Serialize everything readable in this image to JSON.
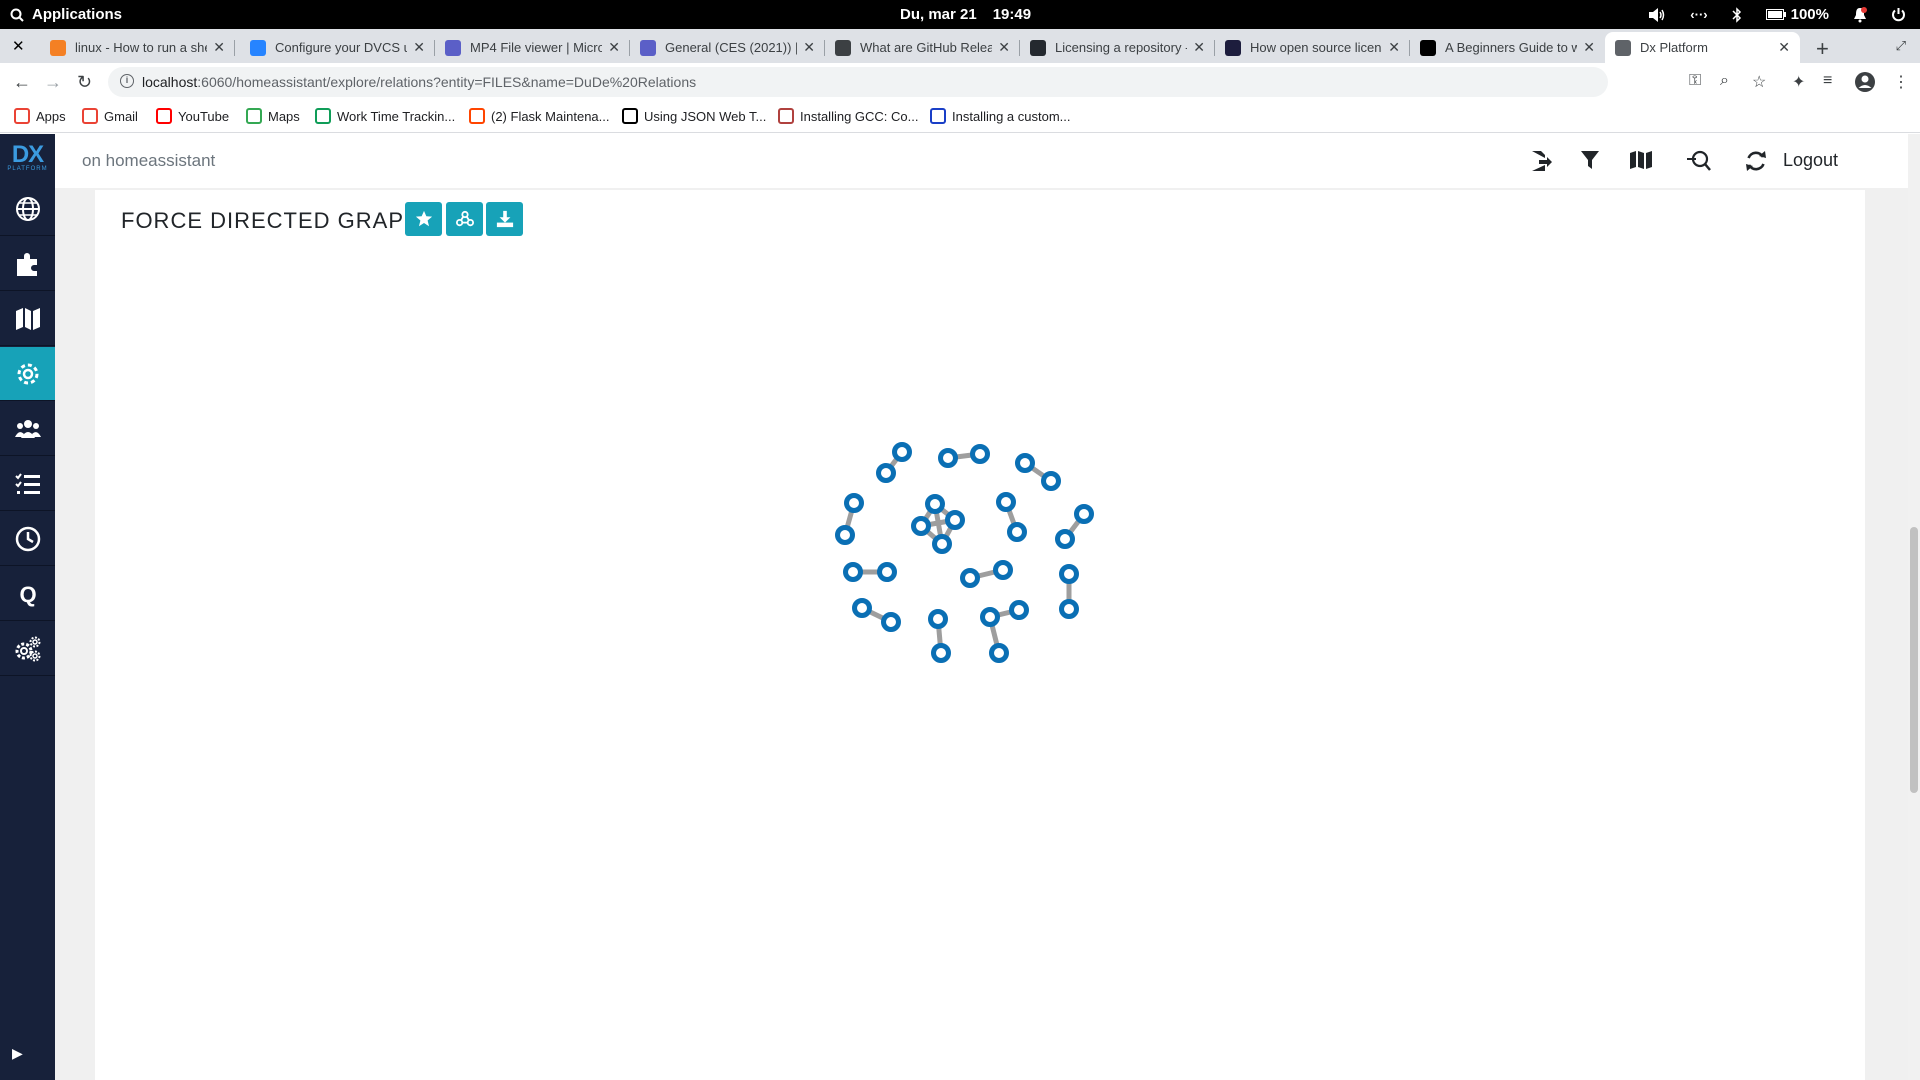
{
  "os_bar": {
    "menu_label": "Applications",
    "date": "Du, mar 21",
    "time": "19:49",
    "battery": "100%"
  },
  "browser": {
    "tabs": [
      {
        "title": "linux - How to run a shell",
        "icon_color": "#f48024",
        "icon": "stackoverflow-icon"
      },
      {
        "title": "Configure your DVCS us",
        "icon_color": "#2684ff",
        "icon": "atlassian-icon"
      },
      {
        "title": "MP4 File viewer | Micro",
        "icon_color": "#5b5fc7",
        "icon": "teams-icon"
      },
      {
        "title": "General (CES (2021)) | ",
        "icon_color": "#5b5fc7",
        "icon": "teams-icon"
      },
      {
        "title": "What are GitHub Relea",
        "icon_color": "#3c4043",
        "icon": "gear-icon"
      },
      {
        "title": "Licensing a repository -",
        "icon_color": "#24292f",
        "icon": "github-icon"
      },
      {
        "title": "How open source licens",
        "icon_color": "#1d1d3d",
        "icon": "opensource-icon"
      },
      {
        "title": "A Beginners Guide to w",
        "icon_color": "#000000",
        "icon": "dev-icon"
      },
      {
        "title": "Dx Platform",
        "icon_color": "#5f6368",
        "icon": "globe-icon"
      }
    ],
    "url_host": "localhost",
    "url_rest": ":6060/homeassistant/explore/relations?entity=FILES&name=DuDe%20Relations",
    "bookmarks": [
      {
        "label": "Apps",
        "icon": "apps-grid-icon",
        "color": "#ea4335"
      },
      {
        "label": "Gmail",
        "icon": "gmail-icon",
        "color": "#ea4335"
      },
      {
        "label": "YouTube",
        "icon": "youtube-icon",
        "color": "#ff0000"
      },
      {
        "label": "Maps",
        "icon": "maps-icon",
        "color": "#34a853"
      },
      {
        "label": "Work Time Trackin...",
        "icon": "sheets-icon",
        "color": "#0f9d58"
      },
      {
        "label": "(2) Flask Maintena...",
        "icon": "reddit-icon",
        "color": "#ff4500"
      },
      {
        "label": "Using JSON Web T...",
        "icon": "dev-icon",
        "color": "#000000"
      },
      {
        "label": "Installing GCC: Co...",
        "icon": "gcc-icon",
        "color": "#b0413e"
      },
      {
        "label": "Installing a custom...",
        "icon": "blue-circle-icon",
        "color": "#1a3fc7"
      }
    ]
  },
  "app": {
    "logo_text": "DX",
    "logo_sub": "PLATFORM",
    "subtitle": "on homeassistant",
    "logout_label": "Logout",
    "accent": "#17a2b8",
    "sidebar_items": [
      {
        "name": "globe",
        "icon": "globe-icon"
      },
      {
        "name": "plugins",
        "icon": "puzzle-icon"
      },
      {
        "name": "map",
        "icon": "map-icon"
      },
      {
        "name": "settings",
        "icon": "cog-icon",
        "active": true
      },
      {
        "name": "users",
        "icon": "users-icon"
      },
      {
        "name": "tasks",
        "icon": "tasks-icon"
      },
      {
        "name": "history",
        "icon": "clock-icon"
      },
      {
        "name": "query",
        "icon": "q-icon"
      },
      {
        "name": "config",
        "icon": "cogs-icon"
      }
    ],
    "graph_title": "FORCE DIRECTED GRAPH",
    "graph": {
      "node_color": "#0a6fb4",
      "link_color": "#9e9e9e",
      "node_count": 38,
      "link_count": 21
    }
  }
}
